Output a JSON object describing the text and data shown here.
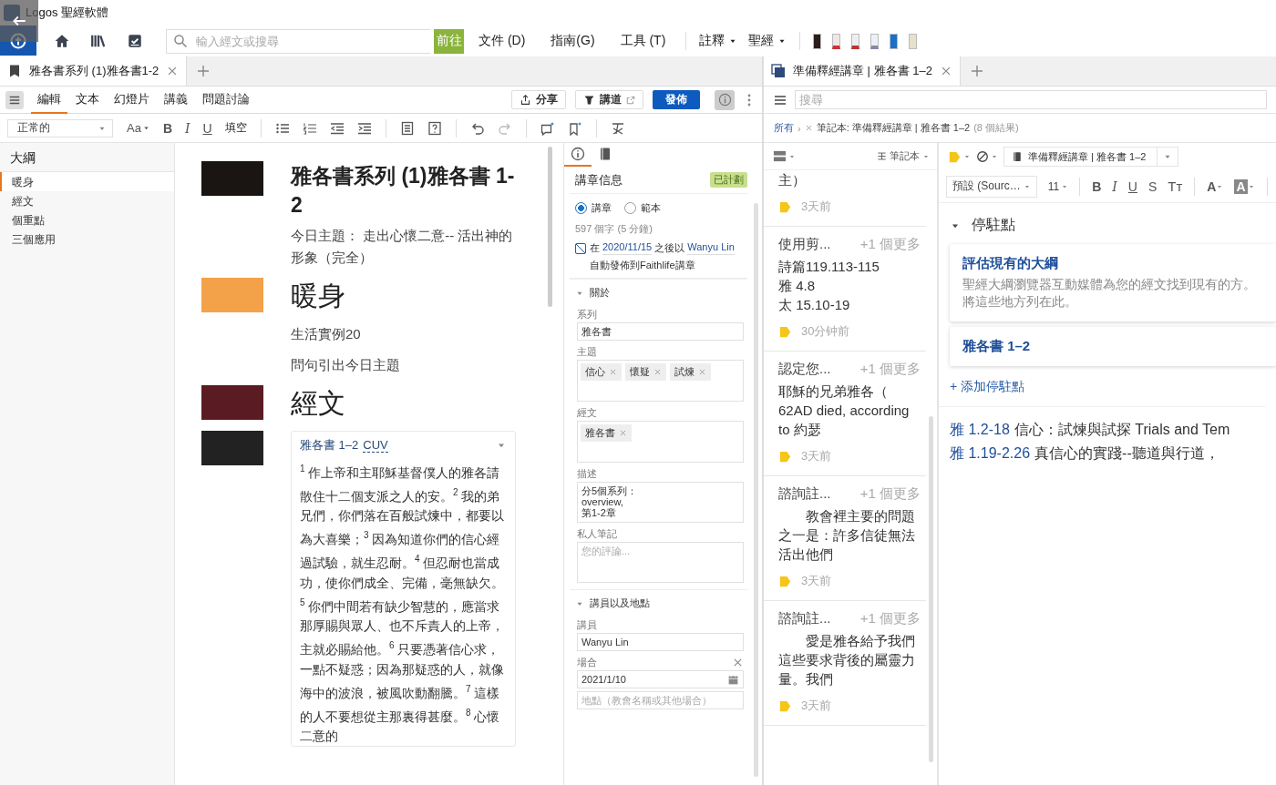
{
  "title_bar": {
    "app_title": "Logos 聖經軟體"
  },
  "toolbar": {
    "search": {
      "placeholder": "輸入經文或搜尋"
    },
    "go_button": "前往",
    "menus": [
      "文件 (D)",
      "指南(G)",
      "工具 (T)"
    ],
    "dropdowns": [
      "註釋",
      "聖經"
    ]
  },
  "left_panel": {
    "tab": {
      "label": "雅各書系列 (1)雅各書1-2"
    },
    "mode_tabs": [
      {
        "label": "編輯",
        "selected": true
      },
      {
        "label": "文本",
        "selected": false
      },
      {
        "label": "幻燈片",
        "selected": false
      },
      {
        "label": "講義",
        "selected": false
      },
      {
        "label": "問題討論",
        "selected": false
      }
    ],
    "actions": {
      "share": "分享",
      "sermon": "講道",
      "publish": "發佈"
    },
    "format_toolbar": {
      "style": "正常的",
      "font_size": "Aa",
      "buttons": [
        {
          "kind": "bold",
          "label": "B"
        },
        {
          "kind": "italic",
          "label": "I"
        },
        {
          "kind": "underline",
          "label": "U"
        },
        {
          "kind": "plain",
          "label": "填空"
        }
      ]
    },
    "outline": {
      "title": "大綱",
      "items": [
        {
          "label": "暖身",
          "selected": true
        },
        {
          "label": "經文",
          "selected": false
        },
        {
          "label": "個重點",
          "selected": false
        },
        {
          "label": "三個應用",
          "selected": false
        }
      ]
    },
    "slides": [
      {
        "kind": "title",
        "title": "雅各書系列 (1)雅各書 1-2",
        "paragraphs": [
          "今日主題： 走出心懷二意-- 活出神的形象（完全）"
        ]
      },
      {
        "kind": "heading",
        "title": "暖身",
        "paragraphs": [
          "生活實例20",
          "問句引出今日主題"
        ]
      },
      {
        "kind": "heading",
        "title": "經文"
      },
      {
        "kind": "passage",
        "reference": "雅各書 1–2",
        "version": "CUV",
        "text": "$^{1}$ 作上帝和主耶穌基督僕人的雅各請散住十二個支派之人的安。$^{2}$ 我的弟兄們，你們落在百般試煉中，都要以為大喜樂；$^{3}$ 因為知道你們的信心經過試驗，就生忍耐。$^{4}$ 但忍耐也當成功，使你們成全、完備，毫無缺欠。$^{5}$ 你們中間若有缺少智慧的，應當求那厚賜與眾人、也不斥責人的上帝，主就必賜給他。$^{6}$ 只要憑著信心求，一點不疑惑；因為那疑惑的人，就像海中的波浪，被風吹動翻騰。$^{7}$ 這樣的人不要想從主那裏得甚麼。$^{8}$ 心懷二意的"
      }
    ],
    "info_panel": {
      "panel_tabs": [
        {
          "kind": "info",
          "selected": true
        },
        {
          "kind": "notes",
          "selected": false
        }
      ],
      "title": "講章信息",
      "status_badge": "已計劃",
      "types": [
        {
          "label": "講章",
          "selected": true
        },
        {
          "label": "範本",
          "selected": false
        }
      ],
      "word_count": "597 個字 (5 分鐘)",
      "auto_publish": {
        "checked": true,
        "prefix": "在",
        "date": "2020/11/15",
        "middle": "之後以",
        "author": "Wanyu Lin",
        "suffix": "自動發佈到Faithlife講章"
      },
      "sections": [
        {
          "title": "關於",
          "expanded": true,
          "fields": [
            {
              "kind": "text",
              "label": "系列",
              "value": "雅各書"
            },
            {
              "kind": "tags",
              "label": "主題",
              "tags": [
                "信心",
                "懷疑",
                "試煉"
              ]
            },
            {
              "kind": "tags",
              "label": "經文",
              "tags": [
                "雅各書"
              ]
            },
            {
              "kind": "textarea",
              "label": "描述",
              "value": "分5個系列：\noverview,\n第1-2章"
            },
            {
              "kind": "textarea",
              "label": "私人筆記",
              "placeholder": "您的評論..."
            }
          ]
        },
        {
          "title": "講員以及地點",
          "expanded": true,
          "fields": [
            {
              "kind": "text",
              "label": "講員",
              "value": "Wanyu Lin"
            },
            {
              "kind": "date",
              "label": "場合",
              "value": "2021/1/10"
            },
            {
              "kind": "text",
              "placeholder": "地點（教會名稱或其他場合）"
            }
          ]
        }
      ]
    }
  },
  "right_panel": {
    "tab": {
      "label": "準備釋經講章 | 雅各書 1–2"
    },
    "search": {
      "placeholder": "搜尋"
    },
    "breadcrumb": {
      "root": "所有",
      "separator": "›",
      "filter": "筆記本: 準備釋經講章 | 雅各書 1–2",
      "count": "(8 個結果)"
    },
    "notes_header": {
      "sort": "筆記本"
    },
    "notes": [
      {
        "body": "主）",
        "time": "3天前"
      },
      {
        "title": "使用剪...",
        "more": "+1 個更多",
        "body": "詩篇119.113-115\n雅 4.8\n太 15.10-19",
        "time": "30分钟前"
      },
      {
        "title": "認定您...",
        "more": "+1 個更多",
        "body": "耶穌的兄弟雅各（ 62AD died, according to 約瑟",
        "time": "3天前"
      },
      {
        "title": "諮詢註...",
        "more": "+1 個更多",
        "body": "教會裡主要的問題之一是：許多信徒無法活出他們",
        "time": "3天前"
      },
      {
        "title": "諮詢註...",
        "more": "+1 個更多",
        "body": "愛是雅各給予我們這些要求背後的屬靈力量。我們",
        "time": "3天前"
      }
    ],
    "editor": {
      "notebook": "準備釋經講章 | 雅各書 1–2",
      "font": "預設 (Sourc…",
      "size": "11",
      "format_buttons": [
        {
          "kind": "bold",
          "label": "B"
        },
        {
          "kind": "italic",
          "label": "I"
        },
        {
          "kind": "underline",
          "label": "U"
        },
        {
          "kind": "strike",
          "label": "S"
        },
        {
          "kind": "case",
          "label": "Tт"
        },
        {
          "kind": "color",
          "label": "A"
        },
        {
          "kind": "highlight",
          "label": "A"
        }
      ],
      "anchors_title": "停駐點",
      "anchors_expanded": true,
      "anchors": [
        {
          "title": "評估現有的大綱",
          "description": "聖經大綱瀏覽器互動媒體為您的經文找到現有的方。將這些地方列在此。"
        },
        {
          "title": "雅各書 1–2"
        }
      ],
      "add_anchor": "+ 添加停駐點",
      "lines": [
        {
          "ref": "雅 1.2-18",
          "text": "信心：試煉與試探 Trials and Tem"
        },
        {
          "ref": "雅 1.19-2.26",
          "text": "真信心的實踐--聽道與行道，"
        }
      ]
    }
  }
}
